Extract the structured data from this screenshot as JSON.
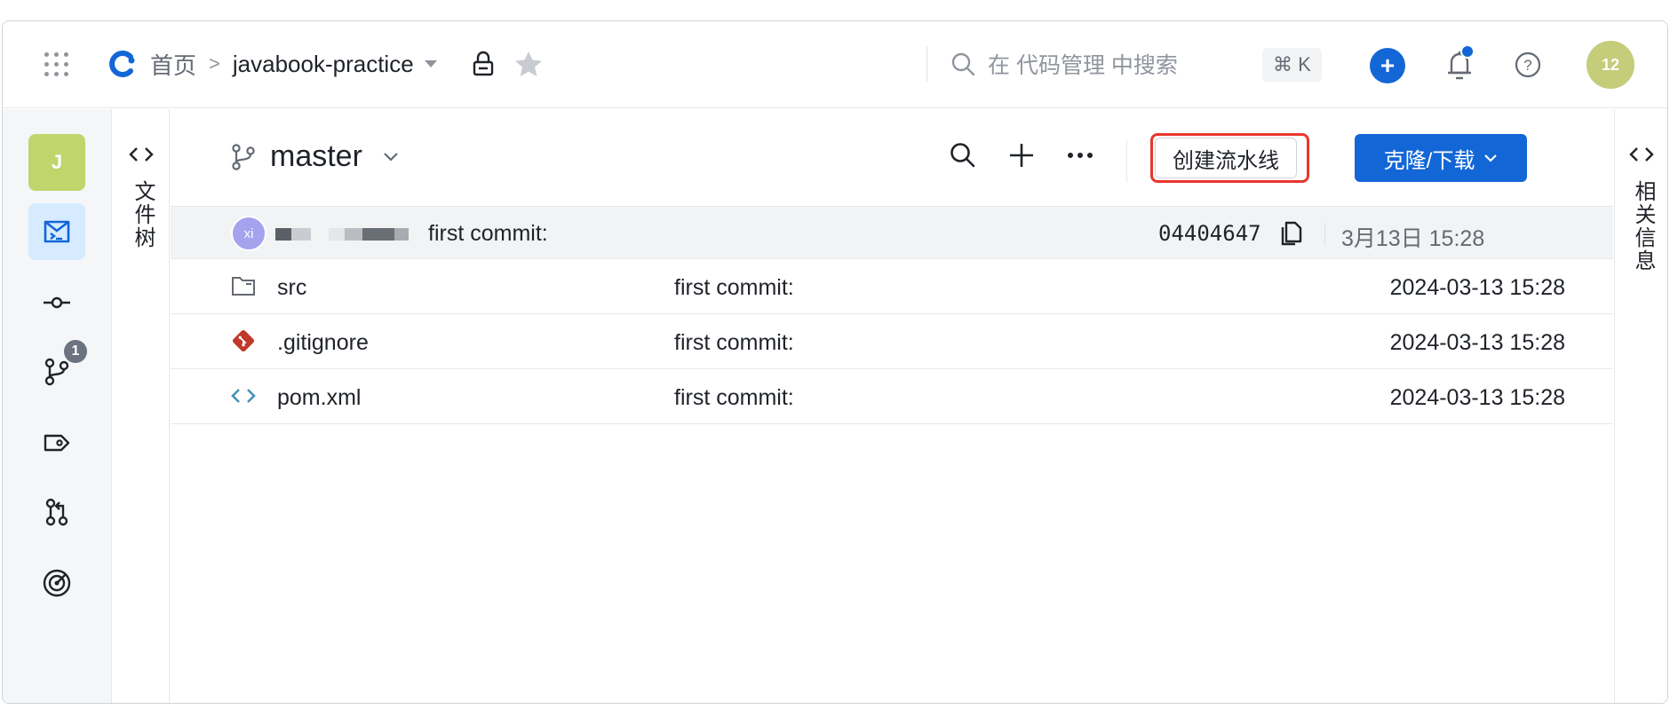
{
  "header": {
    "home": "首页",
    "separator": ">",
    "repo_name": "javabook-practice",
    "search_placeholder": "在 代码管理 中搜索",
    "shortcut": "⌘ K",
    "plus": "+",
    "avatar_text": "12"
  },
  "sidebar": {
    "project_initial": "J",
    "branch_badge": "1",
    "items": [
      "project",
      "code",
      "commits",
      "branches",
      "tags",
      "merge-requests",
      "insights"
    ]
  },
  "file_tree_panel": {
    "toggle": "<>",
    "label": "文件树"
  },
  "right_panel": {
    "toggle": "<>",
    "label": "相关信息"
  },
  "branch": {
    "name": "master"
  },
  "actions": {
    "create_pipeline": "创建流水线",
    "clone_download": "克隆/下载"
  },
  "latest_commit": {
    "author_initials": "xi",
    "message": "first commit:",
    "hash": "04404647",
    "date": "3月13日 15:28"
  },
  "files": [
    {
      "name": "src",
      "type": "folder",
      "message": "first commit:",
      "date": "2024-03-13 15:28"
    },
    {
      "name": ".gitignore",
      "type": "git",
      "message": "first commit:",
      "date": "2024-03-13 15:28"
    },
    {
      "name": "pom.xml",
      "type": "code",
      "message": "first commit:",
      "date": "2024-03-13 15:28"
    }
  ],
  "colors": {
    "accent": "#1366d6",
    "highlight": "#e8372c",
    "git_icon": "#c0392b",
    "code_icon": "#4a90b8"
  }
}
